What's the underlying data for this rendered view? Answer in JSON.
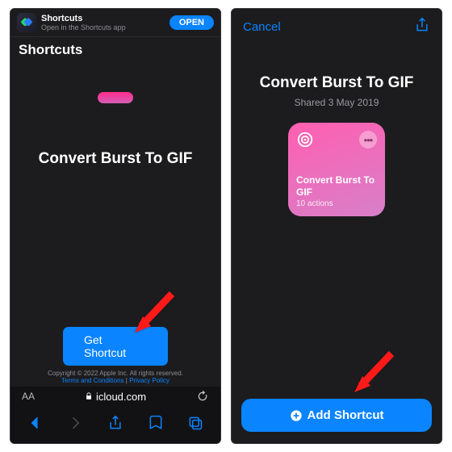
{
  "left": {
    "banner": {
      "title": "Shortcuts",
      "subtitle": "Open in the Shortcuts app",
      "open_label": "OPEN"
    },
    "header_title": "Shortcuts",
    "shortcut_title": "Convert Burst To GIF",
    "get_label": "Get Shortcut",
    "legal": {
      "copyright": "Copyright © 2022 Apple Inc. All rights reserved.",
      "terms": "Terms and Conditions",
      "privacy": "Privacy Policy"
    },
    "url": {
      "aa": "AA",
      "domain": "icloud.com"
    }
  },
  "right": {
    "cancel": "Cancel",
    "title": "Convert Burst To GIF",
    "shared": "Shared 3 May 2019",
    "card": {
      "title": "Convert Burst To GIF",
      "sub": "10 actions"
    },
    "add_label": "Add Shortcut"
  }
}
